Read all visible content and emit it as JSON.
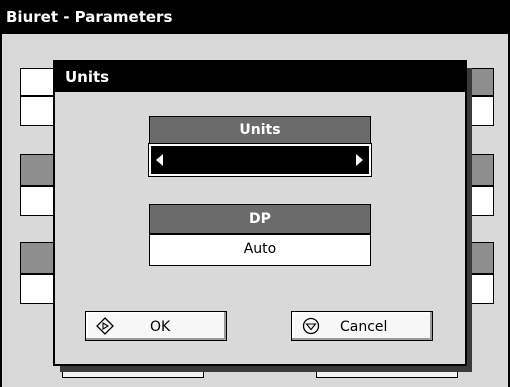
{
  "app": {
    "title": "Biuret - Parameters"
  },
  "background": {
    "buttons": [
      {
        "label": "···  ·····"
      },
      {
        "label": "··  ·······"
      }
    ]
  },
  "dialog": {
    "title": "Units",
    "units": {
      "header": "Units",
      "value": ""
    },
    "dp": {
      "header": "DP",
      "value": "Auto"
    },
    "ok_label": "OK",
    "cancel_label": "Cancel"
  },
  "icons": {
    "ok": "diamond-play-icon",
    "cancel": "circle-stop-icon",
    "left": "arrow-left-icon",
    "right": "arrow-right-icon"
  }
}
